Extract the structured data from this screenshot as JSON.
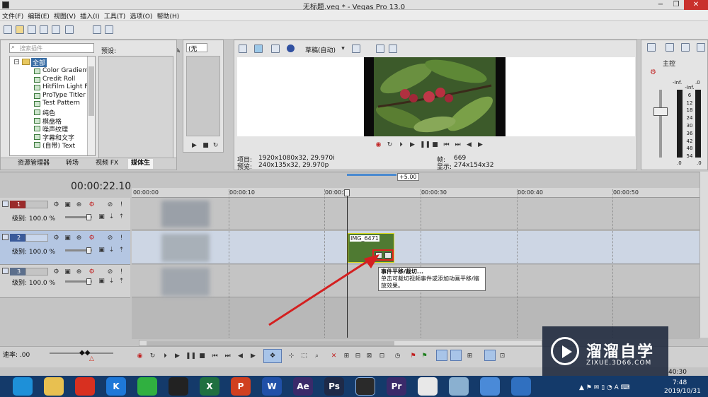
{
  "window": {
    "title": "无标题.veg * - Vegas Pro 13.0",
    "minimize": "−",
    "restore": "❐",
    "close": "✕"
  },
  "menu": [
    "文件(F)",
    "编辑(E)",
    "视图(V)",
    "插入(I)",
    "工具(T)",
    "选项(O)",
    "帮助(H)"
  ],
  "media_panel": {
    "search_placeholder": "搜索插件",
    "preset_label": "预设:",
    "tree": [
      "全部",
      "Color Gradient",
      "Credit Roll",
      "HitFilm Light Fla",
      "ProType Titler",
      "Test Pattern",
      "纯色",
      "棋盘格",
      "噪声纹理",
      "字幕和文字",
      "(自带) Text"
    ],
    "tabs": [
      "资源管理器",
      "转场",
      "视频 FX",
      "媒体生"
    ]
  },
  "trimmer": {
    "dropdown": "(无"
  },
  "preview": {
    "quality": "草稿(自动)",
    "project_label": "项目:",
    "project_value": "1920x1080x32, 29.970i",
    "preview_label": "预览:",
    "preview_value": "240x135x32, 29.970p",
    "frame_label": "帧:",
    "frame_value": "669",
    "display_label": "显示:",
    "display_value": "274x154x32"
  },
  "master_bus": {
    "label": "主控",
    "meter_scale": [
      "-Inf.",
      "6",
      "12",
      "18",
      "24",
      "30",
      "36",
      "42",
      "48",
      "54"
    ],
    "left_value": "-Inf.",
    "right_value": ".0",
    "bottom_left": ".0",
    "bottom_right": ".0"
  },
  "timeline": {
    "timecode": "00:00:22.10",
    "zoom_hint": "+5.00",
    "ruler": [
      "00:00:00",
      "00:00:10",
      "00:00:2",
      "00:00:30",
      "00:00:40",
      "00:00:50"
    ],
    "tracks": [
      {
        "num": "1",
        "level": "级别: 100.0 %"
      },
      {
        "num": "2",
        "level": "级别: 100.0 %"
      },
      {
        "num": "3",
        "level": "级别: 100.0 %"
      }
    ],
    "clip_label": "IMG_6471",
    "rate": "速率: .00",
    "end_time": "40:30"
  },
  "tooltip": {
    "title": "事件平移/裁切...",
    "body": "单击可裁切视频事件或添加动画平移/缩放效果。"
  },
  "watermark": {
    "brand": "溜溜自学",
    "url": "ZIXUE.3D66.COM"
  },
  "taskbar": {
    "time": "7:48",
    "date": "2019/10/31",
    "apps": [
      "chrome-icon",
      "explorer-icon",
      "netease-icon",
      "kugou-icon",
      "wechat-icon",
      "qq-icon",
      "excel-icon",
      "powerpoint-icon",
      "word-icon",
      "aftereffects-icon",
      "photoshop-icon",
      "vegas-icon",
      "premiere-icon",
      "app-icon",
      "app-icon",
      "app-icon",
      "app-icon"
    ],
    "app_letters": [
      "",
      "",
      "",
      "K",
      "",
      "",
      "X",
      "P",
      "W",
      "Ae",
      "Ps",
      "",
      "Pr",
      "",
      "",
      "",
      ""
    ]
  },
  "colors": {
    "accent_red": "#d42020",
    "selection_blue": "#b4c6e2",
    "taskbar_bg": "#143a6a"
  }
}
